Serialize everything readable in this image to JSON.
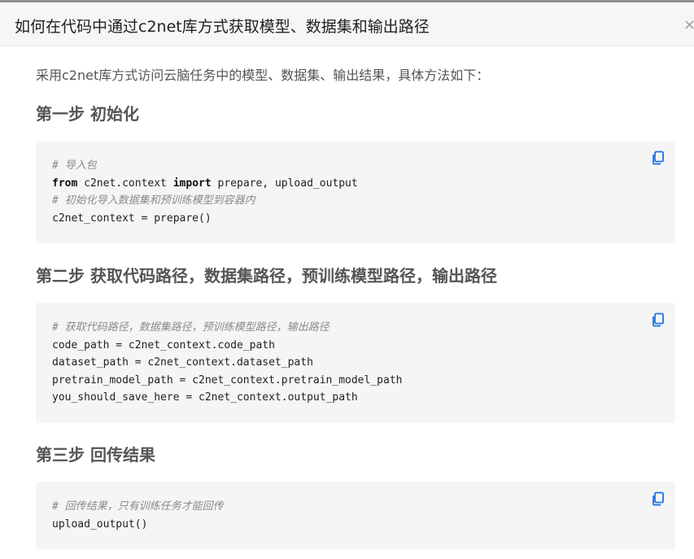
{
  "header": {
    "title": "如何在代码中通过c2net库方式获取模型、数据集和输出路径",
    "close_label": "×"
  },
  "intro": "采用c2net库方式访问云脑任务中的模型、数据集、输出结果，具体方法如下：",
  "steps": [
    {
      "title": "第一步 初始化"
    },
    {
      "title": "第二步 获取代码路径，数据集路径，预训练模型路径，输出路径"
    },
    {
      "title": "第三步 回传结果"
    }
  ],
  "code": {
    "block1": {
      "c1": "# 导入包",
      "kw_from": "from",
      "mod": " c2net.context ",
      "kw_import": "import",
      "names": " prepare, upload_output",
      "c2": "# 初始化导入数据集和预训练模型到容器内",
      "l4": "c2net_context = prepare()"
    },
    "block2": {
      "c1": "# 获取代码路径，数据集路径，预训练模型路径，输出路径",
      "l2": "code_path = c2net_context.code_path",
      "l3": "dataset_path = c2net_context.dataset_path",
      "l4": "pretrain_model_path = c2net_context.pretrain_model_path",
      "l5": "you_should_save_here = c2net_context.output_path"
    },
    "block3": {
      "c1": "# 回传结果，只有训练任务才能回传",
      "l2": "upload_output()"
    }
  },
  "colors": {
    "accent": "#1a73e8",
    "code_bg": "#f5f5f5",
    "header_bg": "#f5f6f7"
  },
  "icons": {
    "copy": "copy-icon",
    "close": "close-icon"
  }
}
